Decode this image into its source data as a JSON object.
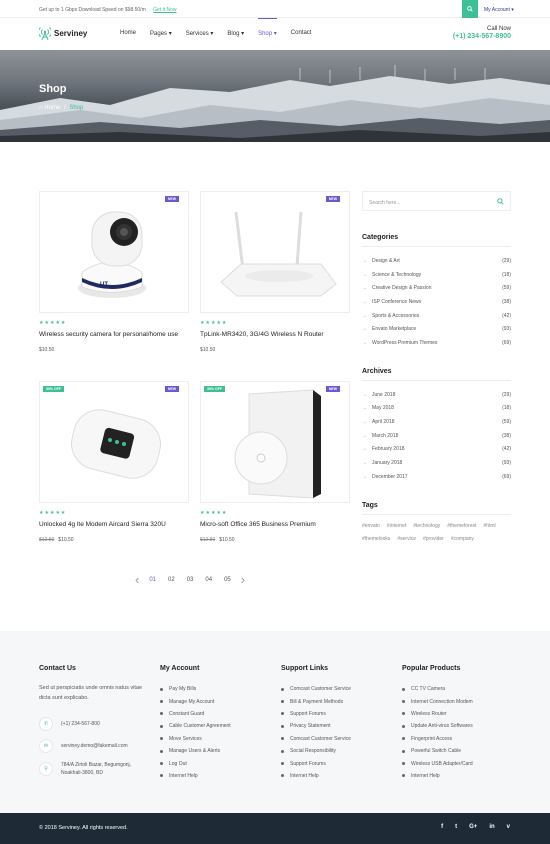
{
  "topbar": {
    "promo_text": "Get up to 1 Gbps Download Speed on $98.50/m",
    "promo_link": "Get it Now",
    "search_icon": "search-icon",
    "account": "My Account ▾"
  },
  "header": {
    "logo_text": "Serviney",
    "nav": [
      "Home",
      "Pages ▾",
      "Services ▾",
      "Blog ▾",
      "Shop ▾",
      "Contact"
    ],
    "active_nav": "Shop ▾",
    "call_label": "Call Now",
    "call_number": "(+1) 234-567-8900"
  },
  "hero": {
    "title": "Shop",
    "breadcrumb_home": "Home",
    "breadcrumb_sep": "/",
    "breadcrumb_current": "Shop"
  },
  "products": [
    {
      "name": "Wireless security camera for personal/home use",
      "price": "$10.50",
      "old_price": "",
      "badge": "NEW",
      "sale": "",
      "stars": "★★★★★"
    },
    {
      "name": "TpLink-MR3420, 3G/4G Wireless N Router",
      "price": "$10.50",
      "old_price": "",
      "badge": "NEW",
      "sale": "",
      "stars": "★★★★★"
    },
    {
      "name": "Unlocked 4g lte Modem Aircard Sierra 320U",
      "price": "$10.50",
      "old_price": "$12.50",
      "badge": "NEW",
      "sale": "30% OFF",
      "stars": "★★★★★"
    },
    {
      "name": "Micro-soft Office 365 Business Premium",
      "price": "$10.50",
      "old_price": "$12.50",
      "badge": "NEW",
      "sale": "30% OFF",
      "stars": "★★★★★"
    }
  ],
  "pagination": {
    "prev": "‹",
    "pages": [
      "01",
      "02",
      "03",
      "04",
      "05"
    ],
    "next": "›"
  },
  "sidebar": {
    "search_placeholder": "Search here...",
    "categories_title": "Categories",
    "categories": [
      {
        "name": "Design & Art",
        "count": "(29)"
      },
      {
        "name": "Science & Technology",
        "count": "(18)"
      },
      {
        "name": "Creative Design & Passion",
        "count": "(59)"
      },
      {
        "name": "ISP Conference News",
        "count": "(38)"
      },
      {
        "name": "Sports & Accessories",
        "count": "(42)"
      },
      {
        "name": "Envato Marketplace",
        "count": "(93)"
      },
      {
        "name": "WordPress Premium Themes",
        "count": "(69)"
      }
    ],
    "archives_title": "Archives",
    "archives": [
      {
        "name": "June 2018",
        "count": "(29)"
      },
      {
        "name": "May 2018",
        "count": "(18)"
      },
      {
        "name": "April 2018",
        "count": "(59)"
      },
      {
        "name": "March 2018",
        "count": "(38)"
      },
      {
        "name": "February 2018",
        "count": "(42)"
      },
      {
        "name": "January 2018",
        "count": "(93)"
      },
      {
        "name": "December 2017",
        "count": "(69)"
      }
    ],
    "tags_title": "Tags",
    "tags": [
      "#envato",
      "#internet",
      "#technology",
      "#themeforest",
      "#html",
      "#themelooks",
      "#service",
      "#provider",
      "#company"
    ]
  },
  "footer": {
    "contact_title": "Contact Us",
    "contact_text": "Sed ut perspiciatis unde omnis natus vitae dicta sunt explicabo.",
    "phone": "(+1) 234-567-800",
    "email": "serviney.demo@fakemail.com",
    "address": "784/A Zirtoli Bazar, Begumgonj, Noakhali-3800, BD",
    "account_title": "My Account",
    "account_links": [
      "Pay My Bills",
      "Manage My Account",
      "Constant Guard",
      "Cable Customer Agreement",
      "Move Services",
      "Manage Users & Alerts",
      "Log Out",
      "Internet Help"
    ],
    "support_title": "Support Links",
    "support_links": [
      "Comcast Customer Service",
      "Bill & Payment Methods",
      "Support Forums",
      "Privacy Statement",
      "Comcast Customer Service",
      "Social Responsibility",
      "Support Forums",
      "Internet Help"
    ],
    "products_title": "Popular Products",
    "products_links": [
      "CC TV Camera",
      "Internet Connection Modem",
      "Wireless Router",
      "Update Anti-virus Softwares",
      "Fingerprint Access",
      "Powerful Switch Cable",
      "Wireless USB Adapter/Card",
      "Internet Help"
    ],
    "copyright": "© 2018 Serviney. All rights reserved.",
    "social": [
      "f",
      "t",
      "G+",
      "in",
      "v"
    ]
  },
  "colors": {
    "accent": "#3fbf96",
    "primary": "#6a5acd",
    "dark": "#1e2b37"
  }
}
